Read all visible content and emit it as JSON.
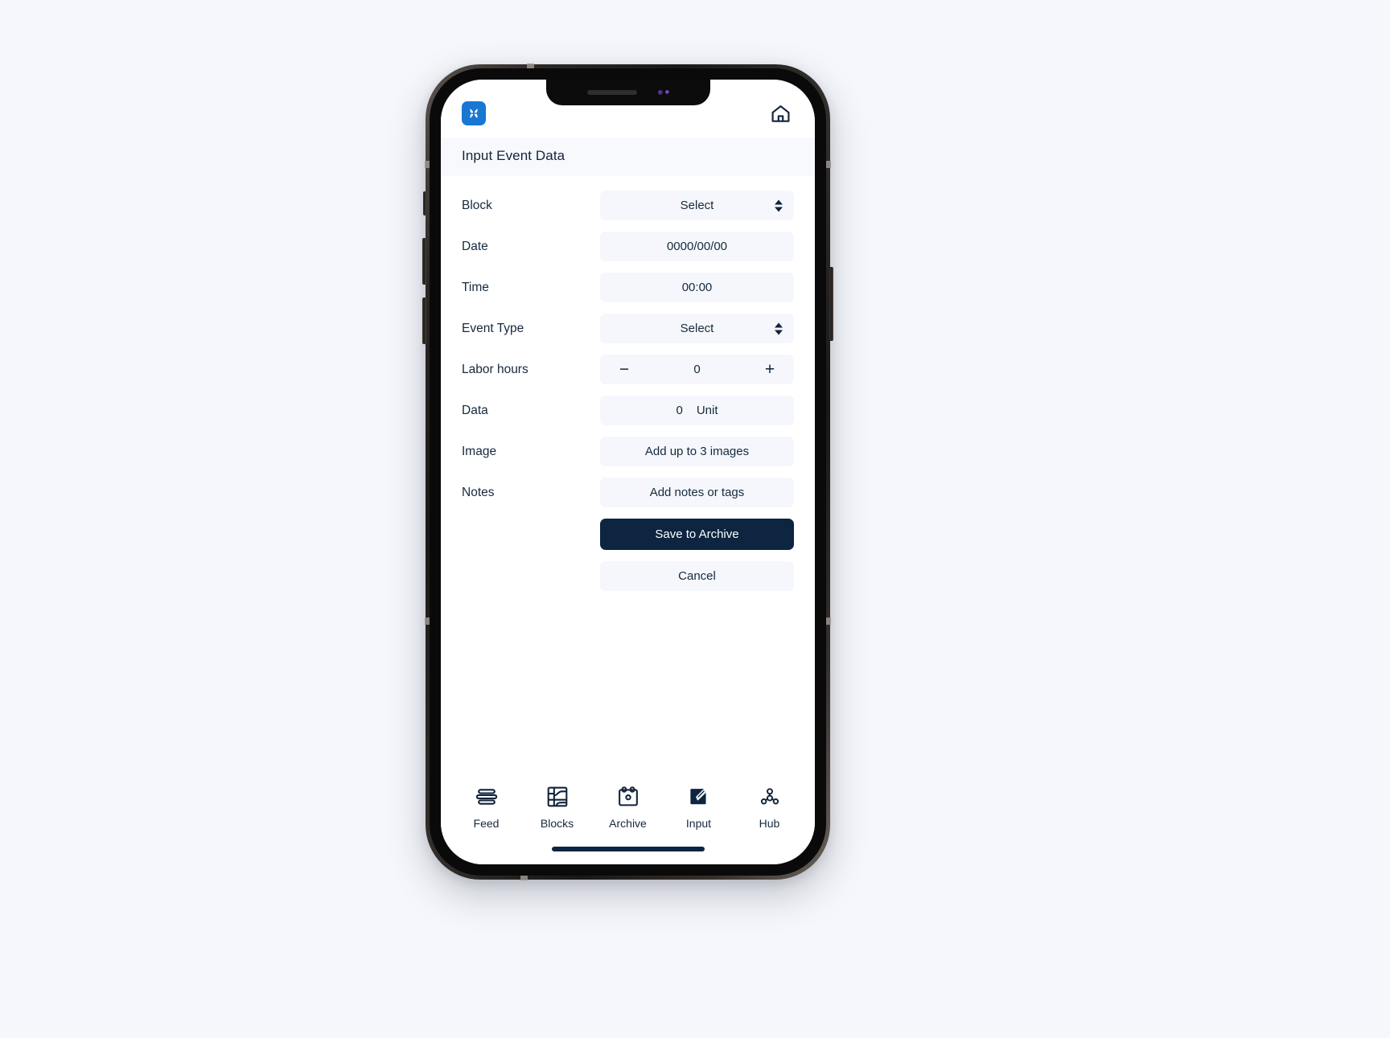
{
  "app": {
    "logo_icon": "app-logo-icon",
    "home_icon": "home-icon",
    "page_title": "Input Event Data"
  },
  "form": {
    "rows": [
      {
        "label": "Block",
        "value": "Select",
        "control": "select"
      },
      {
        "label": "Date",
        "value": "0000/00/00",
        "control": "text"
      },
      {
        "label": "Time",
        "value": "00:00",
        "control": "text"
      },
      {
        "label": "Event Type",
        "value": "Select",
        "control": "select"
      },
      {
        "label": "Labor hours",
        "value": "0",
        "control": "stepper",
        "minus": "−",
        "plus": "+"
      },
      {
        "label": "Data",
        "value": "0",
        "unit": "Unit",
        "control": "data"
      },
      {
        "label": "Image",
        "value": "Add up to 3 images",
        "control": "text"
      },
      {
        "label": "Notes",
        "value": "Add notes or tags",
        "control": "text"
      }
    ],
    "save_label": "Save to Archive",
    "cancel_label": "Cancel"
  },
  "tab_bar": {
    "tabs": [
      {
        "label": "Feed",
        "icon": "feed-icon",
        "active": false
      },
      {
        "label": "Blocks",
        "icon": "blocks-icon",
        "active": false
      },
      {
        "label": "Archive",
        "icon": "archive-icon",
        "active": false
      },
      {
        "label": "Input",
        "icon": "input-icon",
        "active": true
      },
      {
        "label": "Hub",
        "icon": "hub-icon",
        "active": false
      }
    ]
  },
  "colors": {
    "navy": "#0d2540",
    "text": "#16293f",
    "field_bg": "#f5f7fc",
    "logo_blue": "#1877d2",
    "page_bg": "#f5f7fc"
  }
}
